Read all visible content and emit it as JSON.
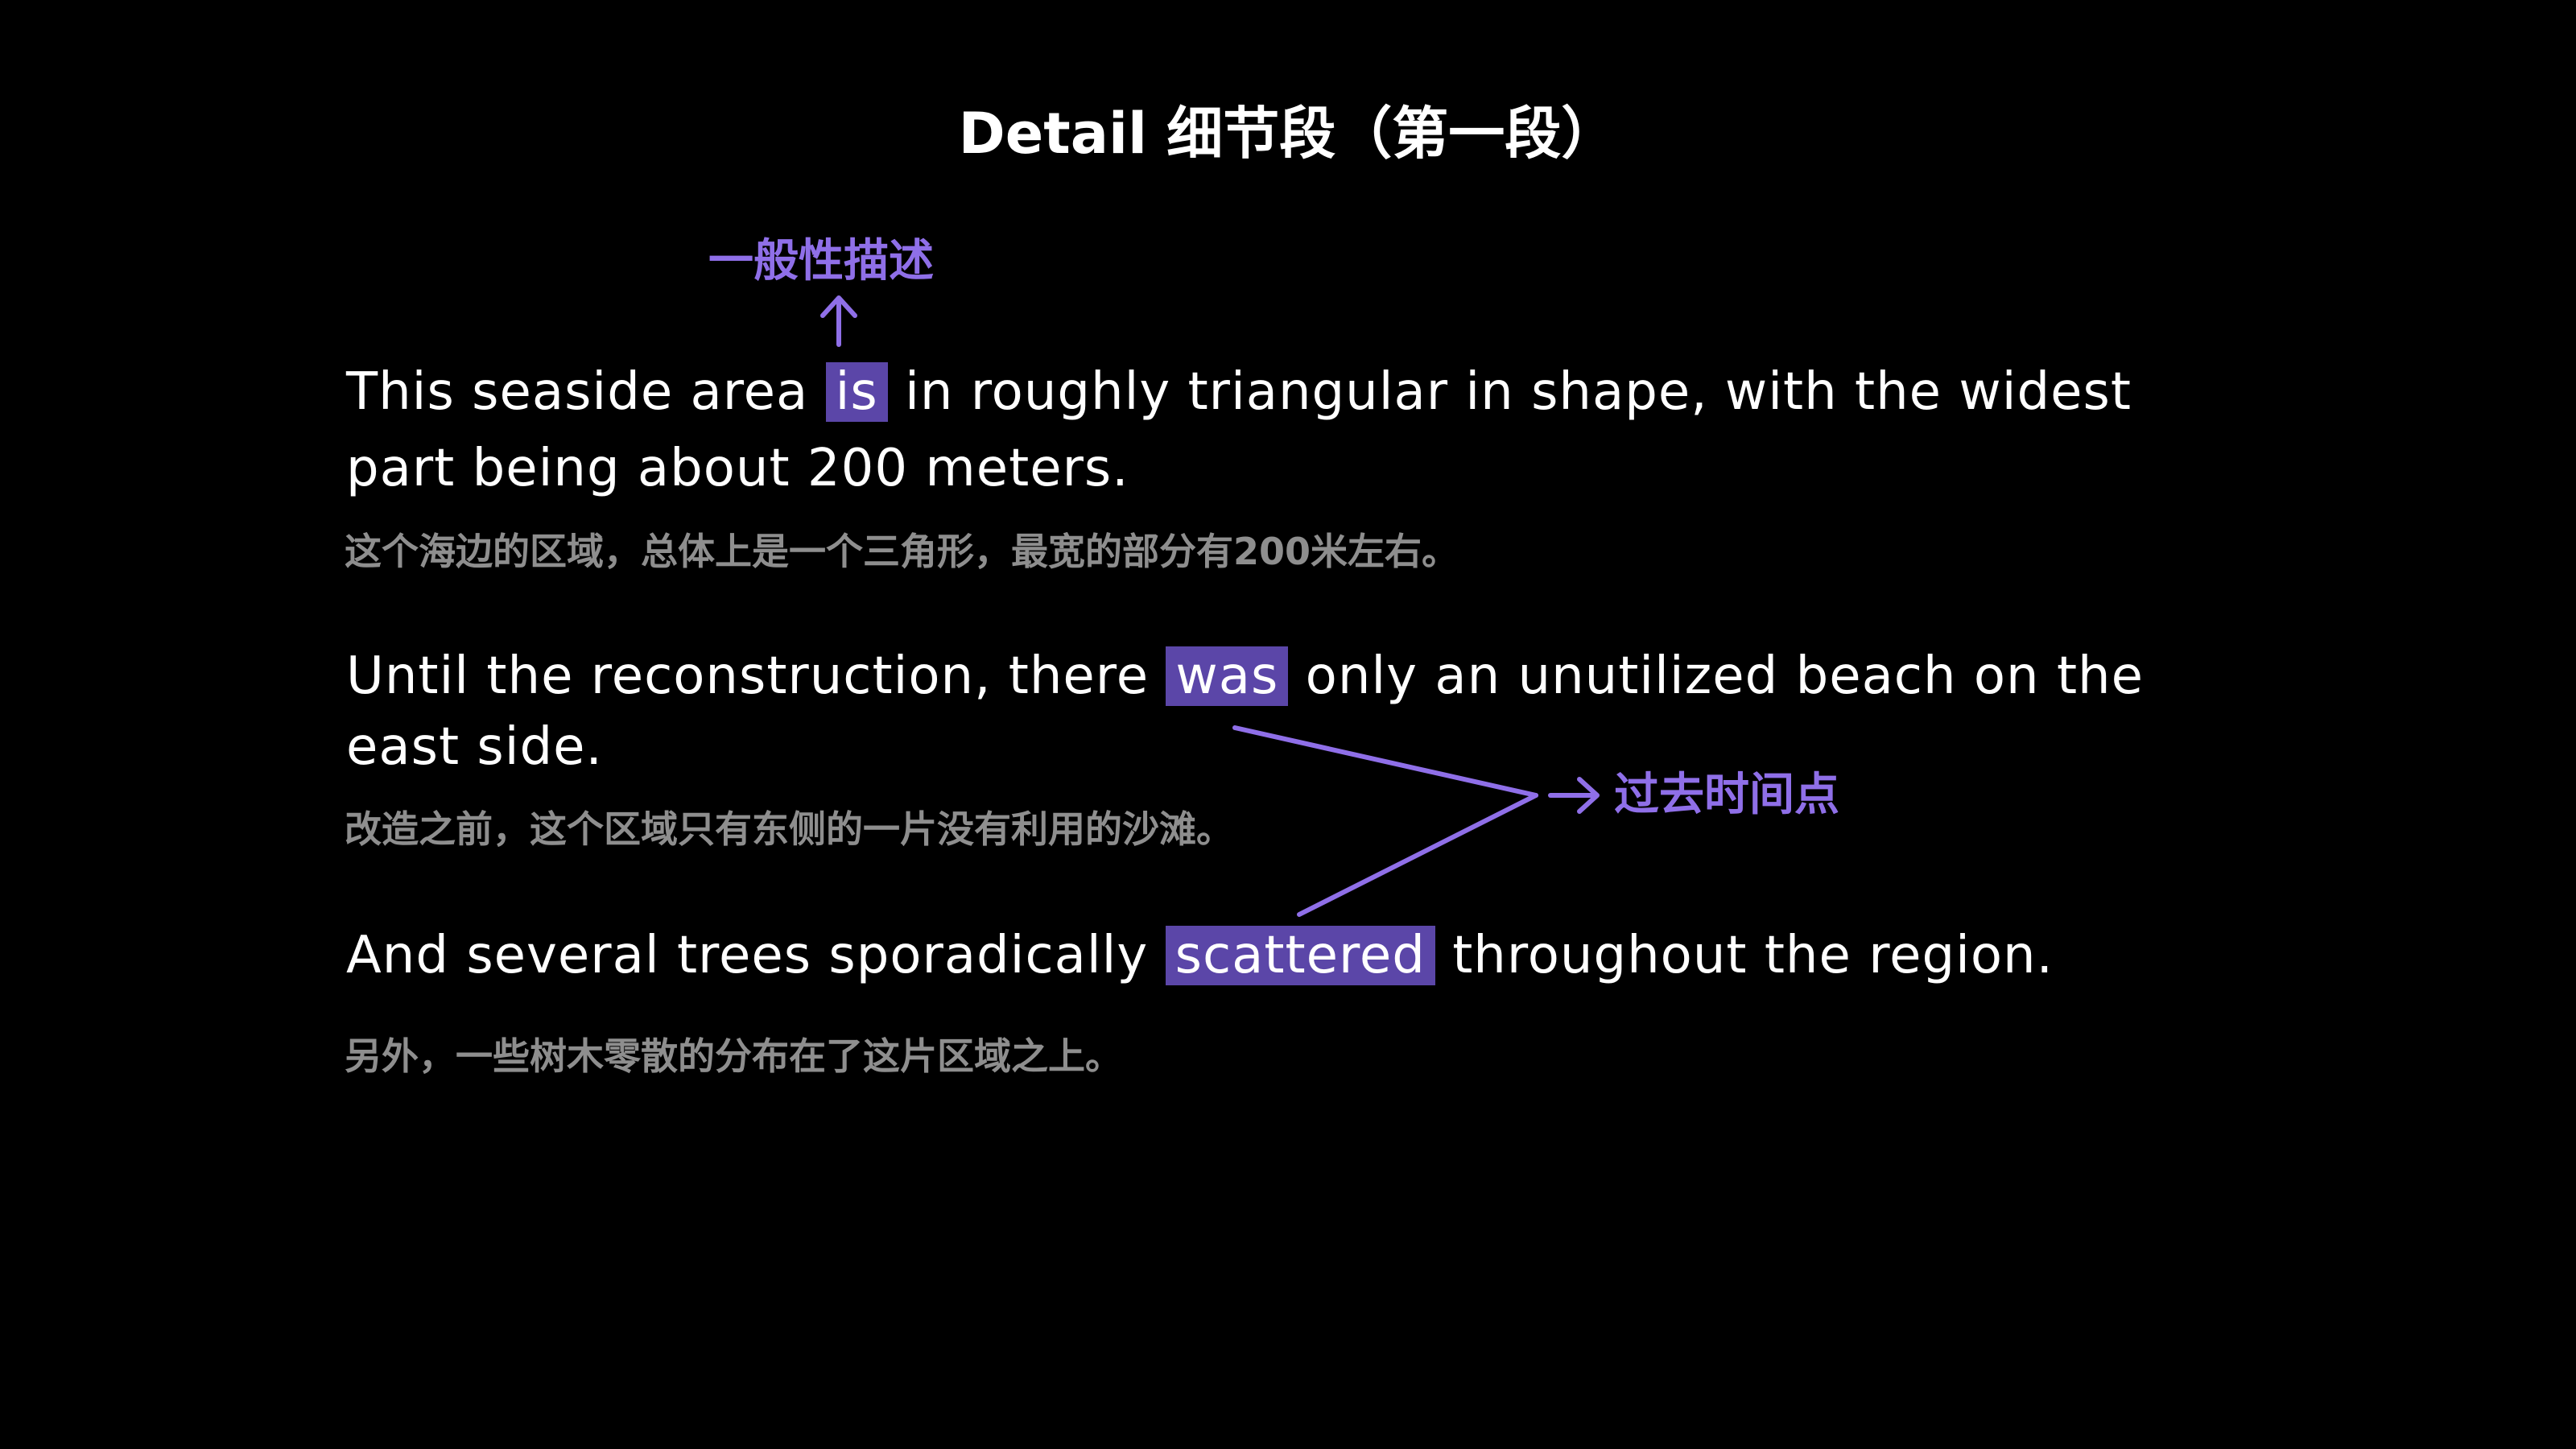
{
  "title": "Detail 细节段（第一段）",
  "colors": {
    "background": "#000000",
    "text": "#ffffff",
    "translation": "#8e8e8e",
    "highlight": "#5b46a8",
    "annotation": "#8f6fe8"
  },
  "sentences": [
    {
      "line1_before": "This seaside area ",
      "highlight": "is",
      "line1_after": " in roughly triangular in shape, with the widest",
      "line2": "part being about 200 meters.",
      "translation": "这个海边的区域，总体上是一个三角形，最宽的部分有200米左右。"
    },
    {
      "line1_before": "Until the reconstruction, there ",
      "highlight": "was",
      "line1_after": " only an unutilized beach on the",
      "line2": "east side.",
      "translation": "改造之前，这个区域只有东侧的一片没有利用的沙滩。"
    },
    {
      "line1_before": "And several trees sporadically ",
      "highlight": "scattered",
      "line1_after": " throughout the region.",
      "translation": "另外，一些树木零散的分布在了这片区域之上。"
    }
  ],
  "annotations": {
    "general": "一般性描述",
    "past": "过去时间点"
  }
}
